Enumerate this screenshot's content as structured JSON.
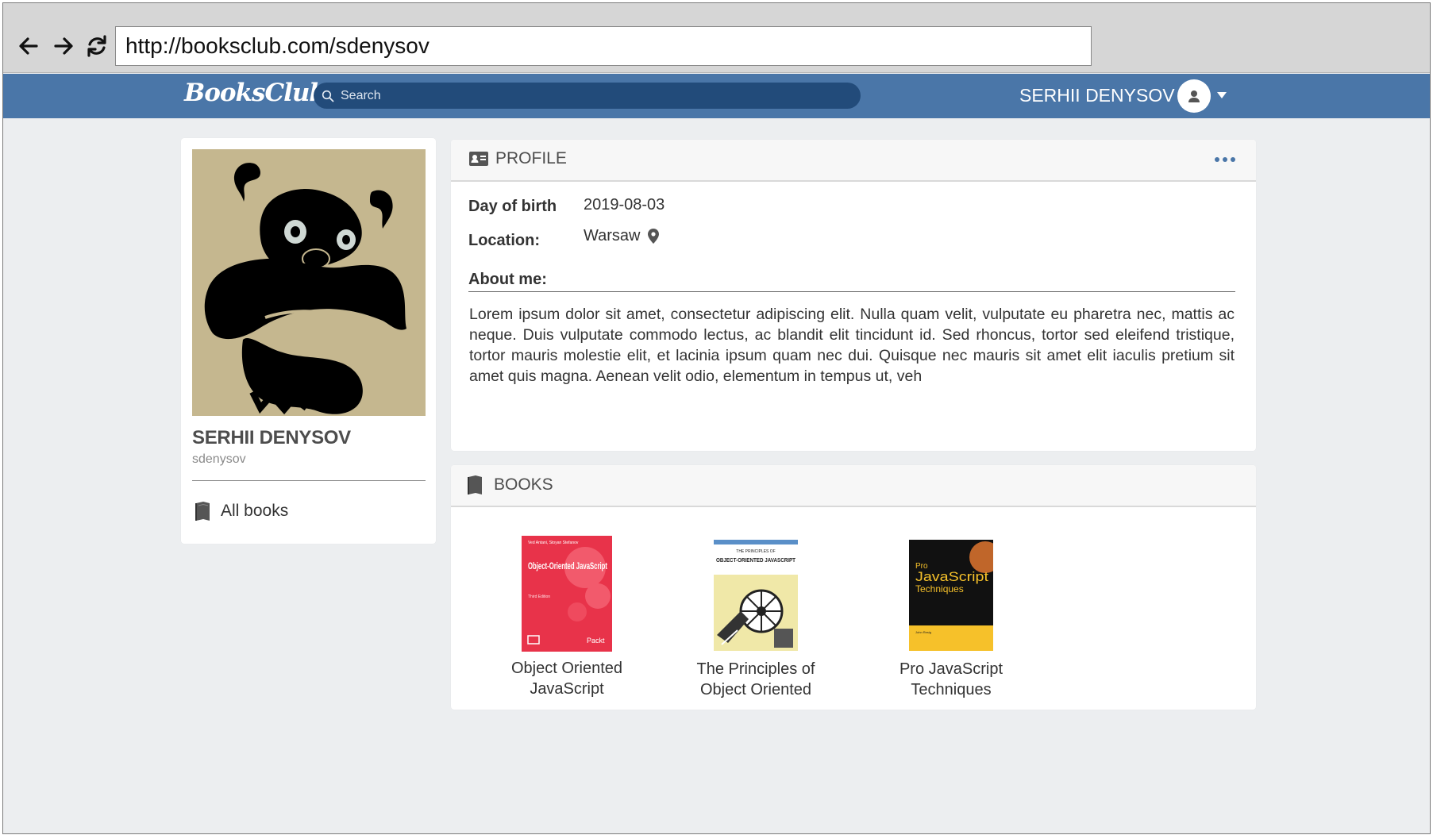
{
  "browser": {
    "back_icon": "arrow-left-icon",
    "forward_icon": "arrow-right-icon",
    "reload_icon": "reload-icon",
    "url": "http://booksclub.com/sdenysov"
  },
  "header": {
    "logo": "BooksClub",
    "search_placeholder": "Search",
    "user_name": "SERHII DENYSOV",
    "brand_color": "#4a76a8"
  },
  "sidebar": {
    "name": "SERHII DENYSOV",
    "username": "sdenysov",
    "all_books_label": "All books"
  },
  "profile": {
    "title": "PROFILE",
    "fields": [
      {
        "label": "Day of birth",
        "value": "2019-08-03"
      },
      {
        "label": "Location:",
        "value": "Warsaw"
      }
    ],
    "about_label": "About me:",
    "about_text": "Lorem ipsum dolor sit amet, consectetur adipiscing elit. Nulla quam velit, vulputate eu pharetra nec, mattis ac neque. Duis vulputate commodo lectus, ac blandit elit tincidunt id. Sed rhoncus, tortor sed eleifend tristique, tortor mauris molestie elit, et lacinia ipsum quam nec dui. Quisque nec mauris sit amet elit iaculis pretium sit amet quis magna. Aenean velit odio, elementum in tempus ut, veh"
  },
  "books": {
    "title": "BOOKS",
    "items": [
      {
        "title_line1": "Object Oriented",
        "title_line2": "JavaScript",
        "cover_top": "Ved Antani, Stoyan Stefanov",
        "cover_title": "Object-Oriented JavaScript",
        "cover_edition": "Third Edition",
        "cover_publisher": "Packt",
        "cover_color": "#e8334a"
      },
      {
        "title_line1": "The Principles of",
        "title_line2": "Object Oriented",
        "cover_top": "THE PRINCIPLES OF",
        "cover_title": "OBJECT-ORIENTED JAVASCRIPT",
        "cover_color": "#f0e8a8"
      },
      {
        "title_line1": "Pro JavaScript",
        "title_line2": "Techniques",
        "cover_pro": "Pro",
        "cover_title": "JavaScript",
        "cover_subtitle": "Techniques",
        "cover_author": "John Resig",
        "cover_color": "#111111"
      }
    ]
  }
}
